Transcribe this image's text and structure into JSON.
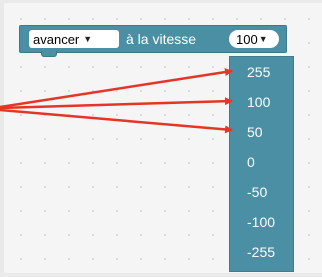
{
  "block": {
    "direction_value": "avancer",
    "label": "à la vitesse",
    "speed_value": "100"
  },
  "menu": {
    "options": [
      "255",
      "100",
      "50",
      "0",
      "-50",
      "-100",
      "-255"
    ]
  },
  "colors": {
    "block": "#4a8fa3",
    "annotation_arrow": "#e53527",
    "workspace": "#f4f5f4"
  },
  "icons": {
    "dropdown": "triangle-down-icon"
  }
}
